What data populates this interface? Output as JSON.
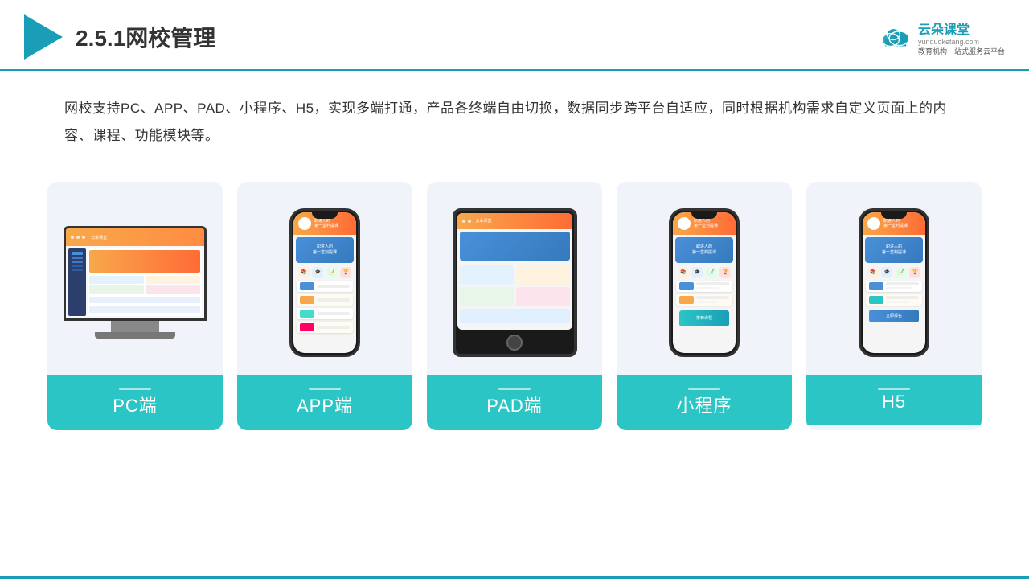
{
  "header": {
    "title": "2.5.1网校管理",
    "brand": {
      "name": "云朵课堂",
      "url": "yunduoketang.com",
      "slogan": "教育机构一站\n式服务云平台"
    }
  },
  "description": "网校支持PC、APP、PAD、小程序、H5，实现多端打通，产品各终端自由切换，数据同步跨平台自适应，同时根据机构需求自定义页面上的内容、课程、功能模块等。",
  "devices": [
    {
      "id": "pc",
      "label": "PC端",
      "type": "pc"
    },
    {
      "id": "app",
      "label": "APP端",
      "type": "phone"
    },
    {
      "id": "pad",
      "label": "PAD端",
      "type": "tablet"
    },
    {
      "id": "miniprogram",
      "label": "小程序",
      "type": "phone2"
    },
    {
      "id": "h5",
      "label": "H5",
      "type": "phone3"
    }
  ],
  "colors": {
    "accent": "#1a9eb8",
    "card_label_bg": "#2cc5c5",
    "header_border": "#1a9eb8"
  }
}
